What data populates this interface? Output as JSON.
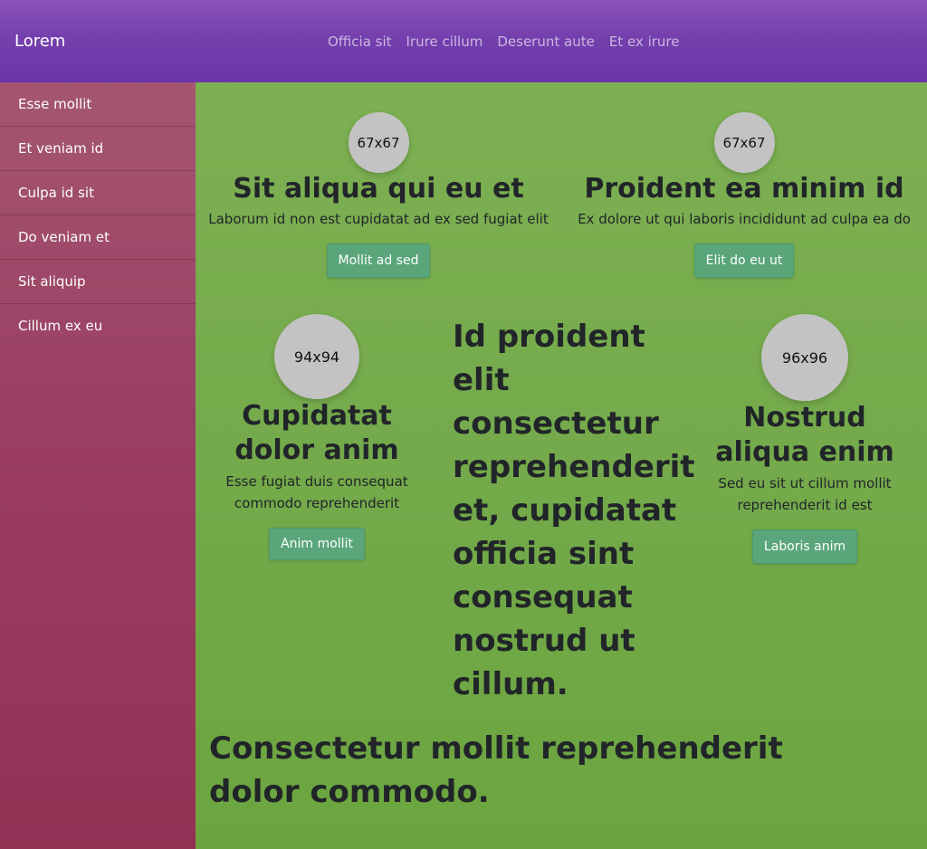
{
  "navbar": {
    "brand": "Lorem",
    "links": [
      "Officia sit",
      "Irure cillum",
      "Deserunt aute",
      "Et ex irure"
    ]
  },
  "sidebar": {
    "items": [
      "Esse mollit",
      "Et veniam id",
      "Culpa id sit",
      "Do veniam et",
      "Sit aliquip",
      "Cillum ex eu"
    ]
  },
  "cards": [
    {
      "avatar": "67x67",
      "title": "Sit aliqua qui eu et",
      "text": "Laborum id non est cupidatat ad ex sed fugiat elit",
      "button": "Mollit ad sed"
    },
    {
      "avatar": "67x67",
      "title": "Proident ea minim id",
      "text": "Ex dolore ut qui laboris incididunt ad culpa ea do",
      "button": "Elit do eu ut"
    },
    {
      "avatar": "94x94",
      "title": "Cupidatat dolor anim",
      "text": "Esse fugiat duis consequat commodo reprehenderit",
      "button": "Anim mollit"
    },
    {
      "avatar": "96x96",
      "title": "Nostrud aliqua enim",
      "text": "Sed eu sit ut cillum mollit reprehenderit id est",
      "button": "Laboris anim"
    }
  ],
  "center_heading": "Id proident elit consectetur reprehenderit et, cupidatat officia sint consequat nostrud ut cillum.",
  "footer_heading": "Consectetur mollit reprehenderit dolor commodo.",
  "colors": {
    "navbar": "#7440ad",
    "sidebar": "#9a3e62",
    "main": "#74aa4b",
    "button": "#5aa67a",
    "avatar": "#c3c3c3"
  }
}
